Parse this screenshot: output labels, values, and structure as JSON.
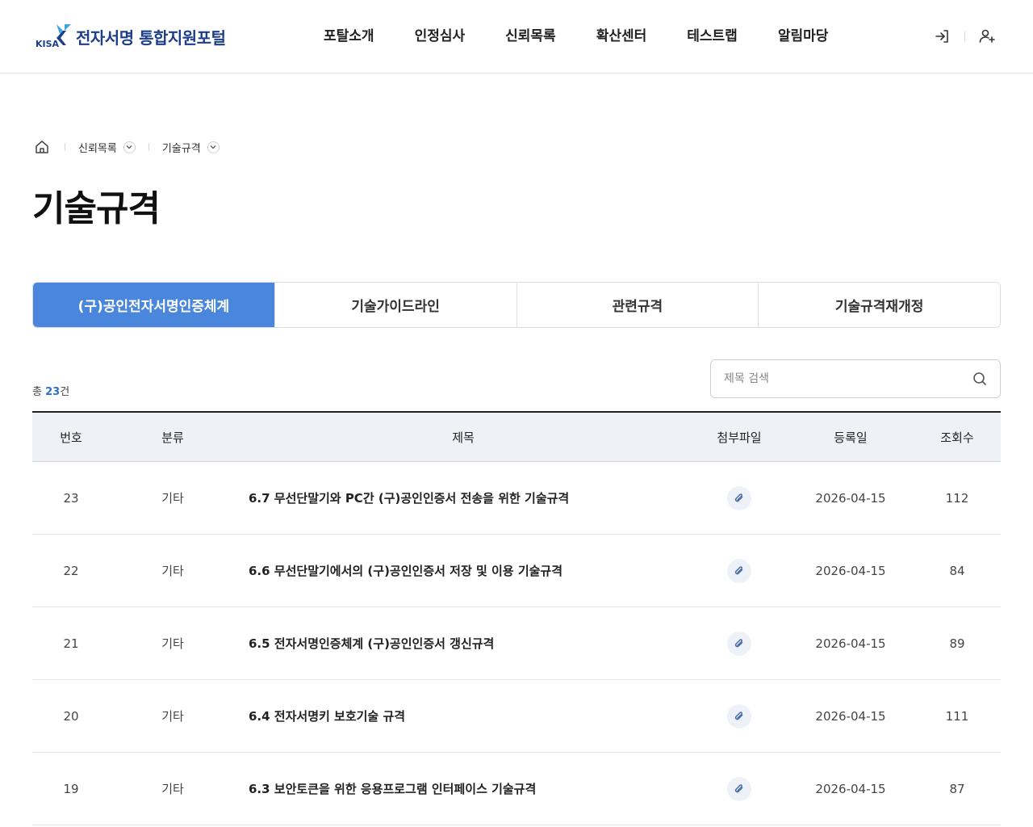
{
  "header": {
    "logo_mark": "KISA",
    "logo_text": "전자서명 통합지원포털",
    "nav": [
      "포탈소개",
      "인정심사",
      "신뢰목록",
      "확산센터",
      "테스트랩",
      "알림마당"
    ],
    "icons": [
      "login-icon",
      "user-add-icon"
    ]
  },
  "breadcrumb": {
    "home_icon": "home-icon",
    "items": [
      "신뢰목록",
      "기술규격"
    ]
  },
  "page_title": "기술규격",
  "tabs": [
    {
      "label": "(구)공인전자서명인증체계",
      "active": true
    },
    {
      "label": "기술가이드라인",
      "active": false
    },
    {
      "label": "관련규격",
      "active": false
    },
    {
      "label": "기술규격재개정",
      "active": false
    }
  ],
  "count": {
    "prefix": "총 ",
    "value": "23",
    "suffix": "건"
  },
  "search": {
    "placeholder": "제목 검색",
    "icon": "search-icon"
  },
  "table": {
    "headers": [
      "번호",
      "분류",
      "제목",
      "첨부파일",
      "등록일",
      "조회수"
    ],
    "rows": [
      {
        "no": "23",
        "cat": "기타",
        "title": "6.7 무선단말기와 PC간 (구)공인인증서 전송을 위한 기술규격",
        "date": "2026-04-15",
        "views": "112"
      },
      {
        "no": "22",
        "cat": "기타",
        "title": "6.6 무선단말기에서의 (구)공인인증서 저장 및 이용 기술규격",
        "date": "2026-04-15",
        "views": "84"
      },
      {
        "no": "21",
        "cat": "기타",
        "title": "6.5 전자서명인증체계 (구)공인인증서 갱신규격",
        "date": "2026-04-15",
        "views": "89"
      },
      {
        "no": "20",
        "cat": "기타",
        "title": "6.4 전자서명키 보호기술 규격",
        "date": "2026-04-15",
        "views": "111"
      },
      {
        "no": "19",
        "cat": "기타",
        "title": "6.3 보안토큰을 위한 응용프로그램 인터페이스 기술규격",
        "date": "2026-04-15",
        "views": "87"
      }
    ]
  },
  "colors": {
    "accent": "#4a86dc",
    "brand": "#1d3f87",
    "count": "#2d6fd0",
    "header_bg": "#eef2f7"
  }
}
